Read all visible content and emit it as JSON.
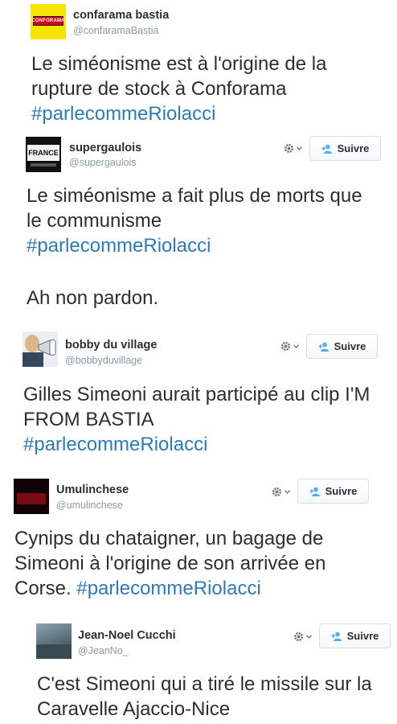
{
  "tweets": [
    {
      "name": "confarama bastia",
      "handle": "@confaramaBastia",
      "avatar_logo_text": "CONFORAMA",
      "text_before": "Le siméonisme est à l'origine de la rupture de stock à Conforama ",
      "hashtag": "#parlecommeRiolacci",
      "text_after": "",
      "has_follow": false
    },
    {
      "name": "supergaulois",
      "handle": "@supergaulois",
      "avatar_logo_text": "FRANCE",
      "text_before": "Le siméonisme a fait plus de morts que le communisme",
      "hashtag": "#parlecommeRiolacci",
      "text_after": "Ah non pardon.",
      "has_follow": true,
      "follow_label": "Suivre"
    },
    {
      "name": "bobby du village",
      "handle": "@bobbyduvillage",
      "text_before": "Gilles Simeoni aurait participé au clip I'M FROM BASTIA",
      "hashtag": "#parlecommeRiolacci",
      "text_after": "",
      "has_follow": true,
      "follow_label": "Suivre"
    },
    {
      "name": "Umulinchese",
      "handle": "@umulinchese",
      "text_before": "Cynips du chataigner, un bagage de Simeoni à l'origine de son arrivée en Corse. ",
      "hashtag": "#parlecommeRiolacci",
      "text_after": "",
      "has_follow": true,
      "follow_label": "Suivre"
    },
    {
      "name": "Jean-Noel Cucchi",
      "handle": "@JeanNo_",
      "text_before": "C'est Simeoni qui a tiré le missile sur la Caravelle Ajaccio-Nice",
      "hashtag": "",
      "text_after": "",
      "has_follow": true,
      "follow_label": "Suivre"
    }
  ],
  "colors": {
    "text": "#292f33",
    "handle": "#8899a6",
    "hashtag": "#2b7bb9",
    "follow_icon": "#55acee",
    "conforama_yellow": "#f7e400"
  },
  "icons": {
    "settings": "gear-icon",
    "follow": "add-user-icon"
  }
}
